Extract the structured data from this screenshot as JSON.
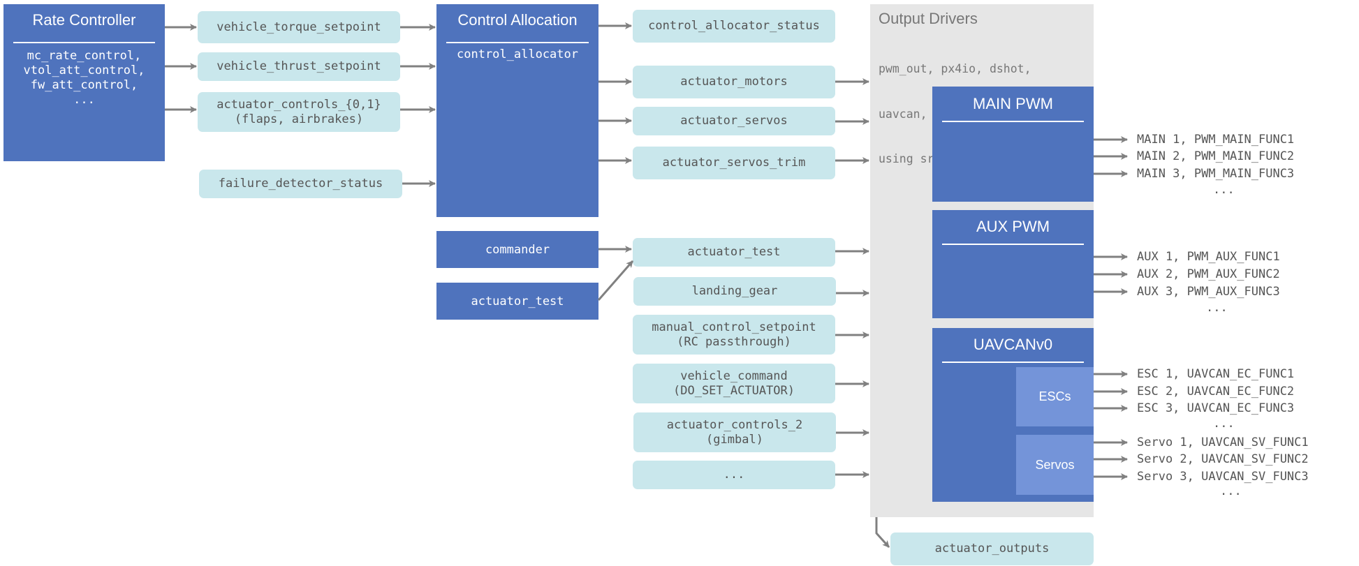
{
  "rate_controller": {
    "title": "Rate Controller",
    "modules": [
      "mc_rate_control,",
      "vtol_att_control,",
      "fw_att_control,",
      "..."
    ]
  },
  "rate_outputs": [
    {
      "lines": [
        "vehicle_torque_setpoint"
      ]
    },
    {
      "lines": [
        "vehicle_thrust_setpoint"
      ]
    },
    {
      "lines": [
        "actuator_controls_{0,1}",
        "(flaps, airbrakes)"
      ]
    }
  ],
  "failure_detector": {
    "lines": [
      "failure_detector_status"
    ]
  },
  "control_allocation": {
    "title": "Control Allocation",
    "module": "control_allocator"
  },
  "allocator_outputs": [
    {
      "lines": [
        "control_allocator_status"
      ]
    },
    {
      "lines": [
        "actuator_motors"
      ]
    },
    {
      "lines": [
        "actuator_servos"
      ]
    },
    {
      "lines": [
        "actuator_servos_trim"
      ]
    }
  ],
  "side_modules": {
    "commander": "commander",
    "actuator_test": "actuator_test"
  },
  "other_inputs": [
    {
      "lines": [
        "actuator_test"
      ]
    },
    {
      "lines": [
        "landing_gear"
      ]
    },
    {
      "lines": [
        "manual_control_setpoint",
        "(RC passthrough)"
      ]
    },
    {
      "lines": [
        "vehicle_command",
        "(DO_SET_ACTUATOR)"
      ]
    },
    {
      "lines": [
        "actuator_controls_2",
        "(gimbal)"
      ]
    },
    {
      "lines": [
        "..."
      ]
    }
  ],
  "output_drivers": {
    "title": "Output Drivers",
    "description": [
      "pwm_out, px4io, dshot,",
      "uavcan, ...",
      "using src/libs/mixer_module"
    ],
    "groups": {
      "main": {
        "title": "MAIN PWM",
        "outputs": [
          "MAIN 1, PWM_MAIN_FUNC1",
          "MAIN 2, PWM_MAIN_FUNC2",
          "MAIN 3, PWM_MAIN_FUNC3",
          "..."
        ]
      },
      "aux": {
        "title": "AUX PWM",
        "outputs": [
          "AUX 1, PWM_AUX_FUNC1",
          "AUX 2, PWM_AUX_FUNC2",
          "AUX 3, PWM_AUX_FUNC3",
          "..."
        ]
      },
      "uavcan": {
        "title": "UAVCANv0",
        "escs": {
          "label": "ESCs",
          "outputs": [
            "ESC 1, UAVCAN_EC_FUNC1",
            "ESC 2, UAVCAN_EC_FUNC2",
            "ESC 3, UAVCAN_EC_FUNC3",
            "..."
          ]
        },
        "servos": {
          "label": "Servos",
          "outputs": [
            "Servo 1, UAVCAN_SV_FUNC1",
            "Servo 2, UAVCAN_SV_FUNC2",
            "Servo 3, UAVCAN_SV_FUNC3",
            "..."
          ]
        }
      }
    }
  },
  "actuator_outputs": {
    "lines": [
      "actuator_outputs"
    ]
  },
  "colors": {
    "module_blue": "#4f73bd",
    "sub_module_blue": "#7494d9",
    "topic_cyan": "#c9e7ec",
    "driver_gray": "#e6e6e6",
    "arrow_gray": "#808080",
    "text_gray": "#555555"
  }
}
